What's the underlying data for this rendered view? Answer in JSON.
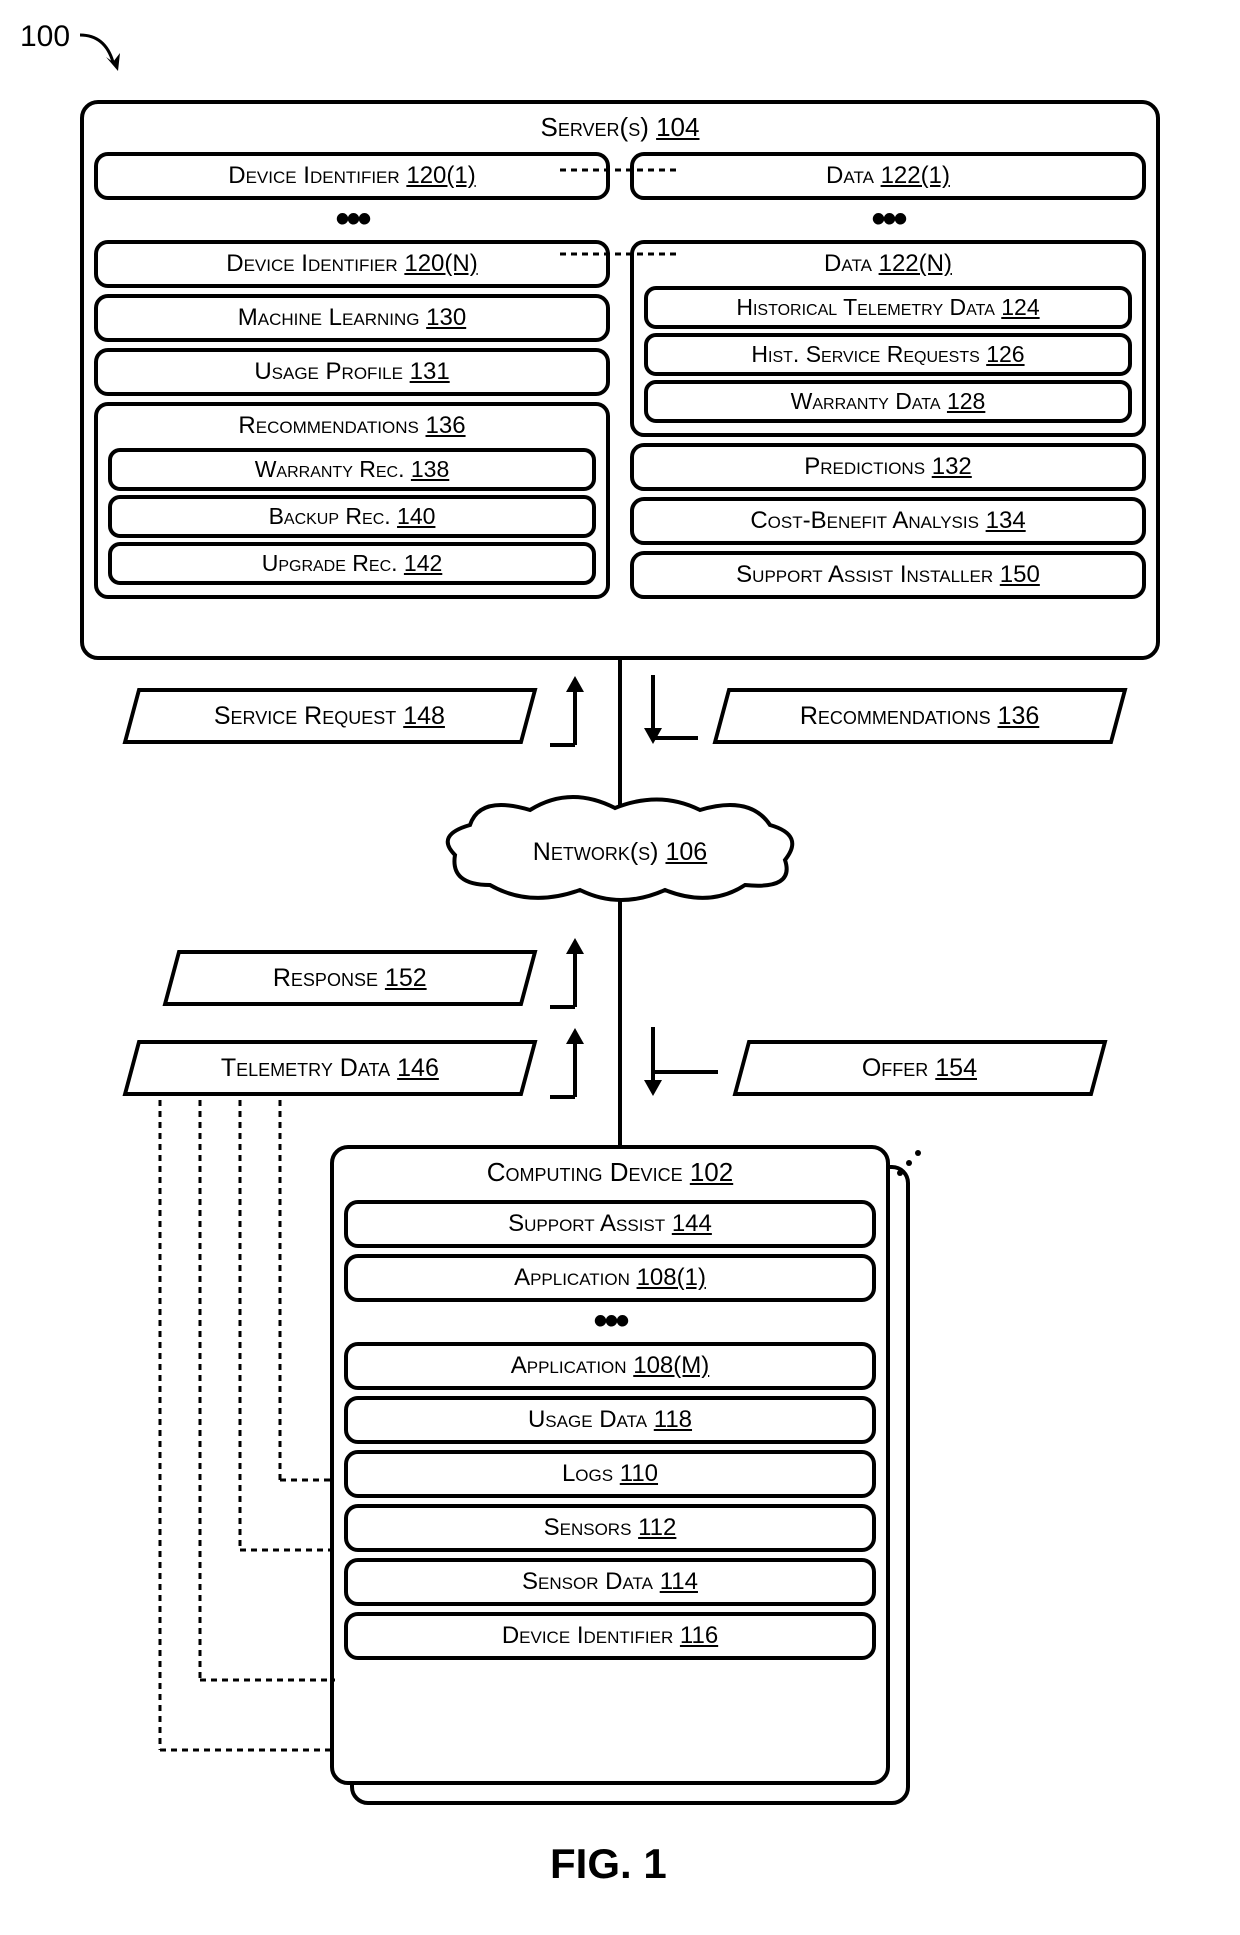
{
  "fig_ref": "100",
  "fig_caption": "FIG. 1",
  "server": {
    "title_text": "Server(s)",
    "title_num": "104",
    "left": {
      "device_id_1": {
        "text": "Device Identifier",
        "num": "120(1)"
      },
      "device_id_n": {
        "text": "Device Identifier",
        "num": "120(N)"
      },
      "ml": {
        "text": "Machine Learning",
        "num": "130"
      },
      "usage_profile": {
        "text": "Usage Profile",
        "num": "131"
      },
      "recs": {
        "title_text": "Recommendations",
        "title_num": "136",
        "warranty": {
          "text": "Warranty Rec.",
          "num": "138"
        },
        "backup": {
          "text": "Backup Rec.",
          "num": "140"
        },
        "upgrade": {
          "text": "Upgrade Rec.",
          "num": "142"
        }
      }
    },
    "right": {
      "data_1": {
        "text": "Data",
        "num": "122(1)"
      },
      "data_n": {
        "title_text": "Data",
        "title_num": "122(N)",
        "hist_tel": {
          "text": "Historical Telemetry Data",
          "num": "124"
        },
        "hist_svc": {
          "text": "Hist. Service Requests",
          "num": "126"
        },
        "warranty": {
          "text": "Warranty Data",
          "num": "128"
        }
      },
      "predictions": {
        "text": "Predictions",
        "num": "132"
      },
      "cba": {
        "text": "Cost-Benefit Analysis",
        "num": "134"
      },
      "sai": {
        "text": "Support Assist Installer",
        "num": "150"
      }
    }
  },
  "msgs": {
    "service_request": {
      "text": "Service Request",
      "num": "148"
    },
    "recommendations": {
      "text": "Recommendations",
      "num": "136"
    },
    "response": {
      "text": "Response",
      "num": "152"
    },
    "telemetry": {
      "text": "Telemetry Data",
      "num": "146"
    },
    "offer": {
      "text": "Offer",
      "num": "154"
    }
  },
  "network": {
    "text": "Network(s)",
    "num": "106"
  },
  "device": {
    "title_text": "Computing Device",
    "title_num": "102",
    "support_assist": {
      "text": "Support Assist",
      "num": "144"
    },
    "app_1": {
      "text": "Application",
      "num": "108(1)"
    },
    "app_m": {
      "text": "Application",
      "num": "108(M)"
    },
    "usage_data": {
      "text": "Usage Data",
      "num": "118"
    },
    "logs": {
      "text": "Logs",
      "num": "110"
    },
    "sensors": {
      "text": "Sensors",
      "num": "112"
    },
    "sensor_data": {
      "text": "Sensor Data",
      "num": "114"
    },
    "device_id": {
      "text": "Device Identifier",
      "num": "116"
    }
  }
}
